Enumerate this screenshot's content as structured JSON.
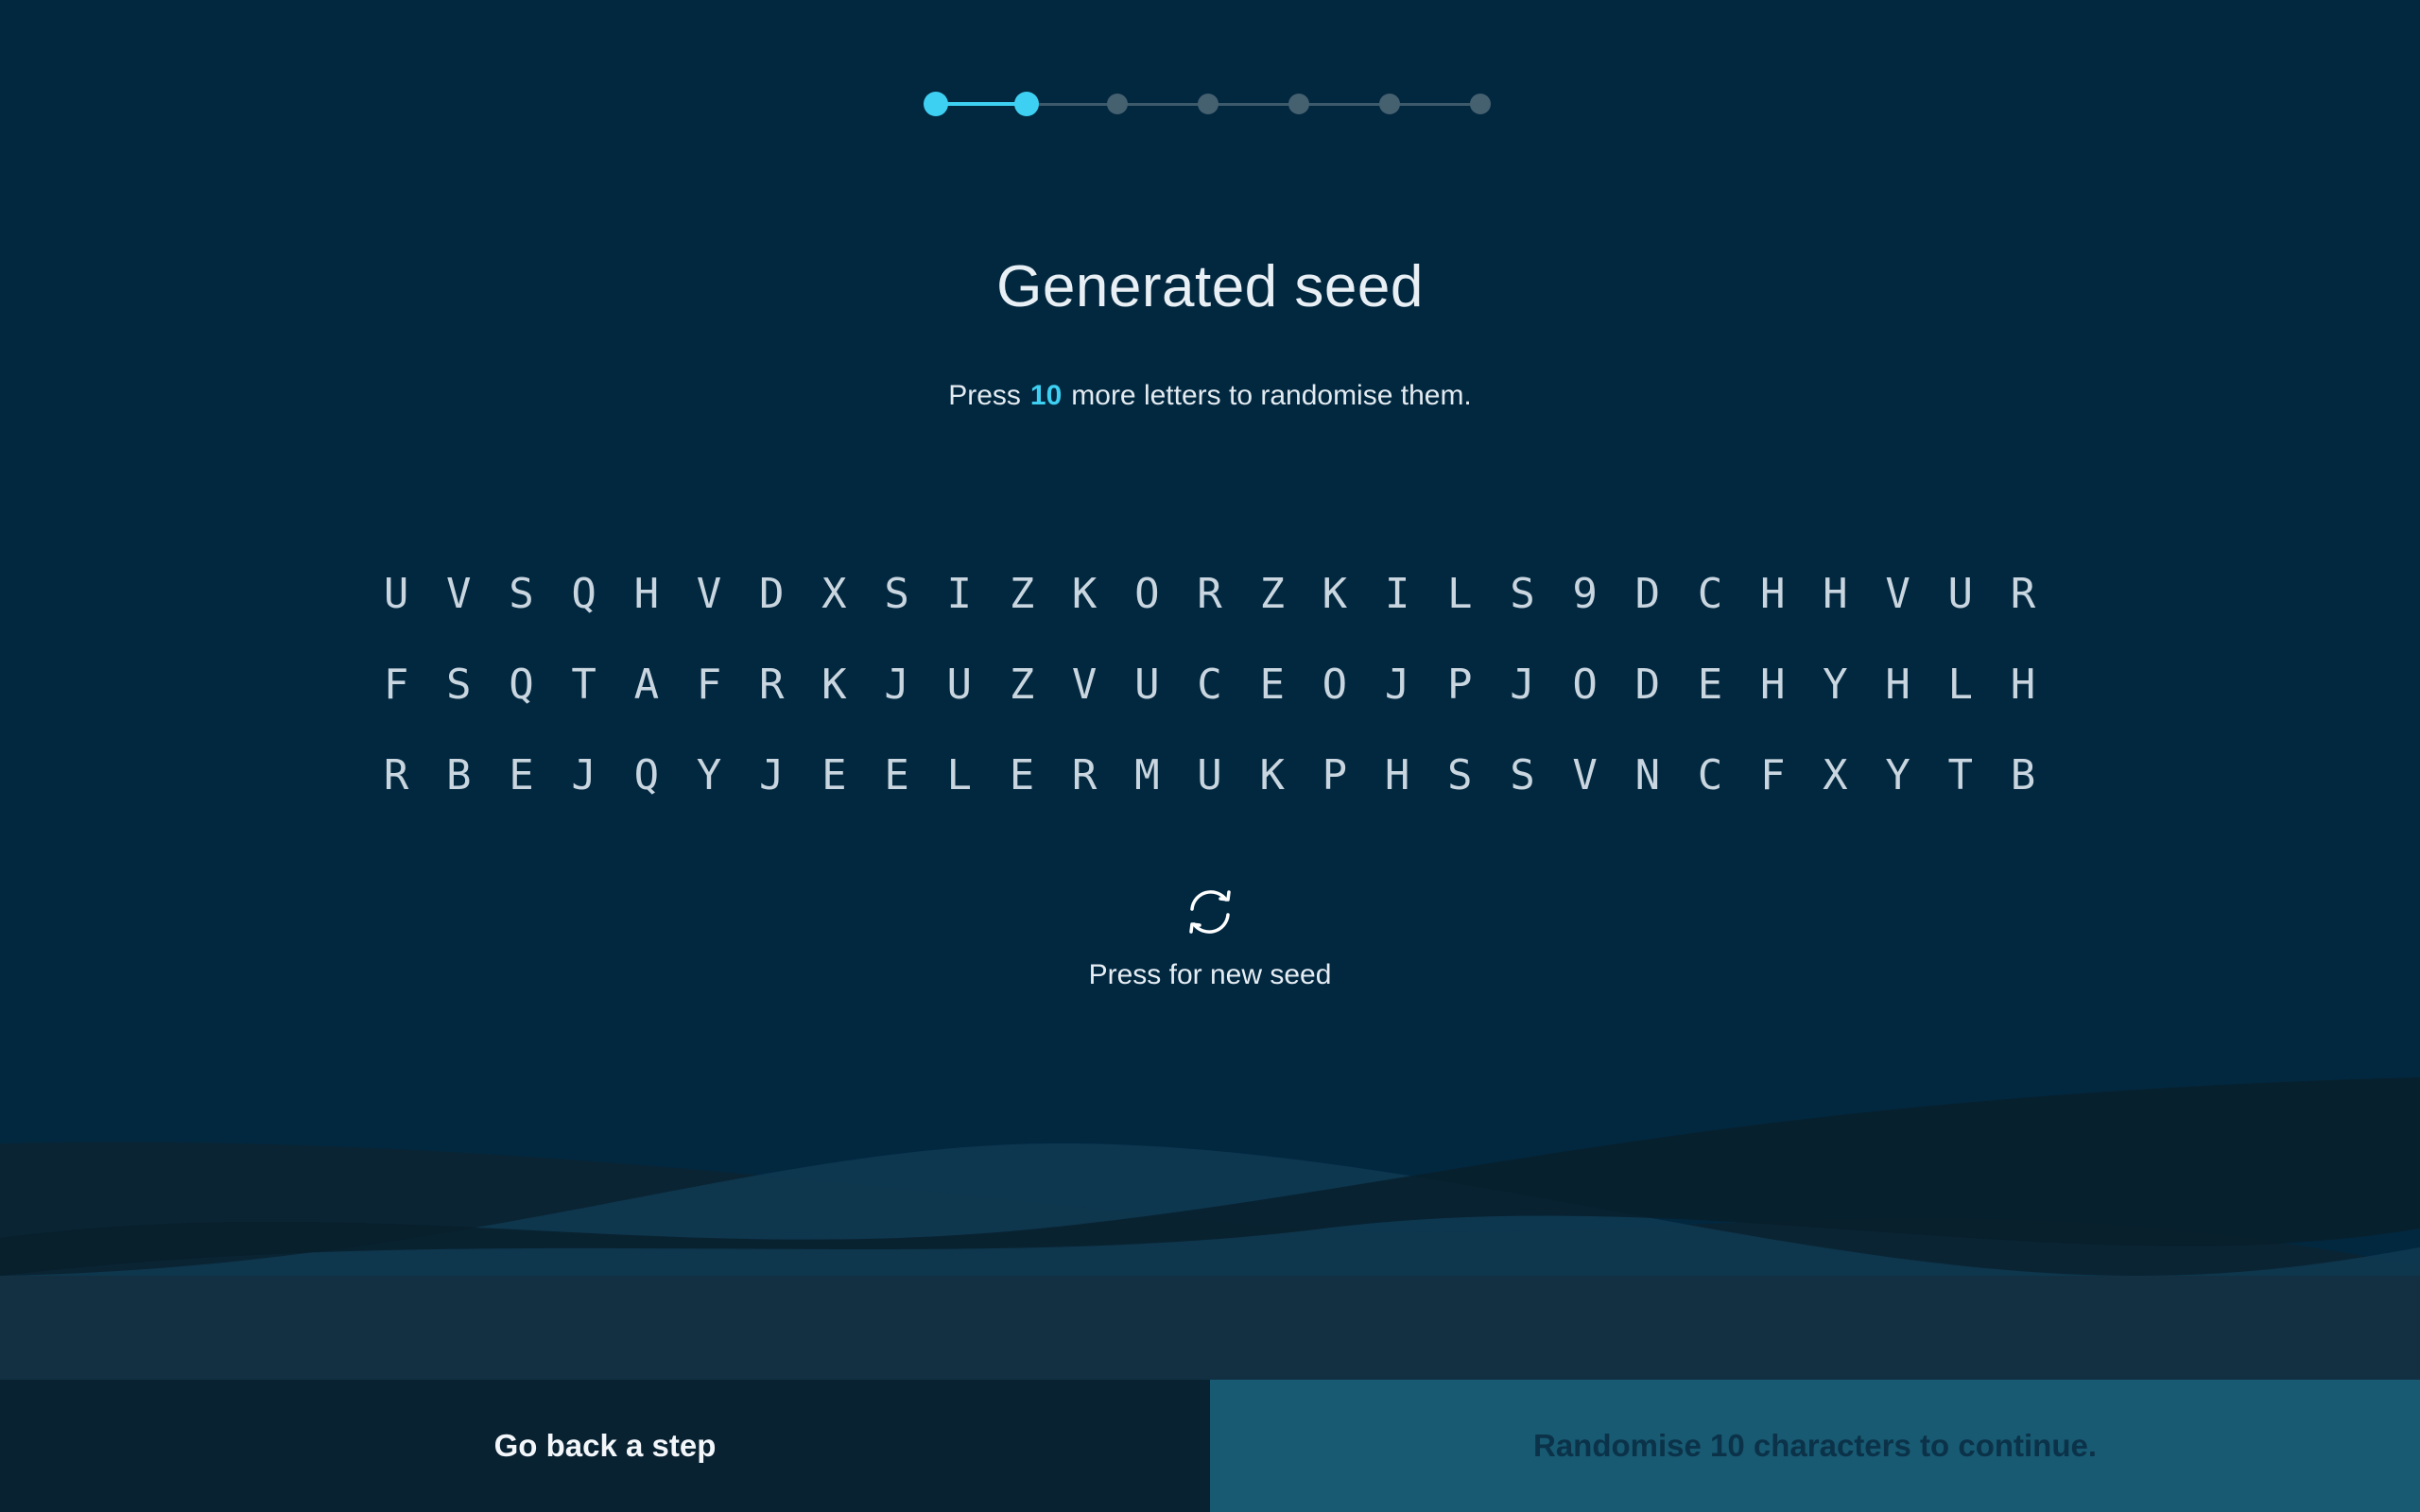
{
  "stepper": {
    "total_steps": 7,
    "current_step": 2
  },
  "header": {
    "title": "Generated seed"
  },
  "instruction": {
    "prefix": "Press",
    "count": "10",
    "suffix": "more letters to randomise them."
  },
  "seed": {
    "rows": [
      [
        "U",
        "V",
        "S",
        "Q",
        "H",
        "V",
        "D",
        "X",
        "S",
        "I",
        "Z",
        "K",
        "O",
        "R",
        "Z",
        "K",
        "I",
        "L",
        "S",
        "9",
        "D",
        "C",
        "H",
        "H",
        "V",
        "U",
        "R"
      ],
      [
        "F",
        "S",
        "Q",
        "T",
        "A",
        "F",
        "R",
        "K",
        "J",
        "U",
        "Z",
        "V",
        "U",
        "C",
        "E",
        "O",
        "J",
        "P",
        "J",
        "O",
        "D",
        "E",
        "H",
        "Y",
        "H",
        "L",
        "H"
      ],
      [
        "R",
        "B",
        "E",
        "J",
        "Q",
        "Y",
        "J",
        "E",
        "E",
        "L",
        "E",
        "R",
        "M",
        "U",
        "K",
        "P",
        "H",
        "S",
        "S",
        "V",
        "N",
        "C",
        "F",
        "X",
        "Y",
        "T",
        "B"
      ]
    ]
  },
  "new_seed": {
    "icon": "refresh-icon",
    "label": "Press for new seed"
  },
  "footer": {
    "back_label": "Go back a step",
    "continue_label": "Randomise 10 characters to continue."
  },
  "colors": {
    "background": "#022840",
    "accent": "#3ed0f2",
    "back_button": "#082232",
    "continue_button": "#175a72"
  }
}
